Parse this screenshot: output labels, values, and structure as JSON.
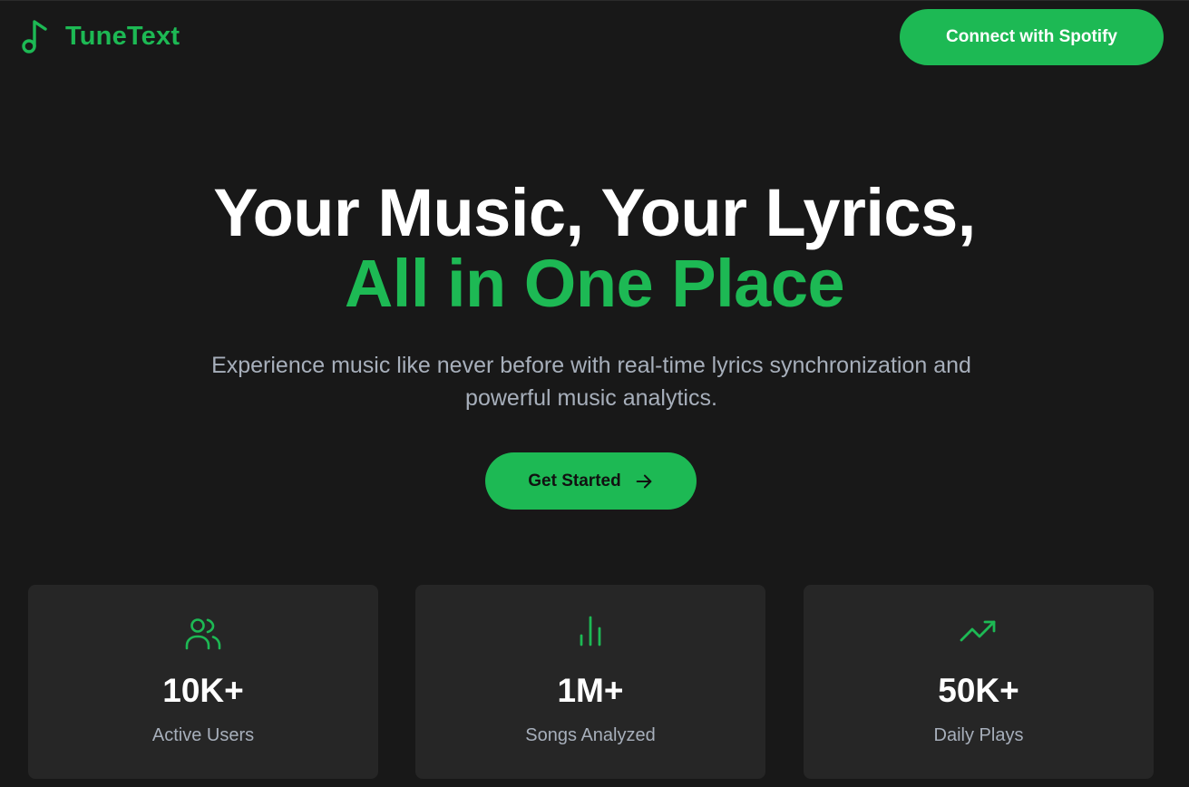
{
  "header": {
    "brand": "TuneText",
    "logo_icon": "music-note-icon",
    "connect_label": "Connect with Spotify"
  },
  "hero": {
    "title_line1": "Your Music, Your Lyrics,",
    "title_line2": "All in One Place",
    "subtitle": "Experience music like never before with real-time lyrics synchronization and powerful music analytics.",
    "cta_label": "Get Started",
    "cta_icon": "arrow-right-icon"
  },
  "stats": [
    {
      "icon": "users-icon",
      "value": "10K+",
      "label": "Active Users"
    },
    {
      "icon": "bar-chart-icon",
      "value": "1M+",
      "label": "Songs Analyzed"
    },
    {
      "icon": "trending-up-icon",
      "value": "50K+",
      "label": "Daily Plays"
    }
  ],
  "colors": {
    "accent": "#1DB954",
    "background": "#181818",
    "card": "#262626",
    "muted_text": "#a7afbb"
  }
}
